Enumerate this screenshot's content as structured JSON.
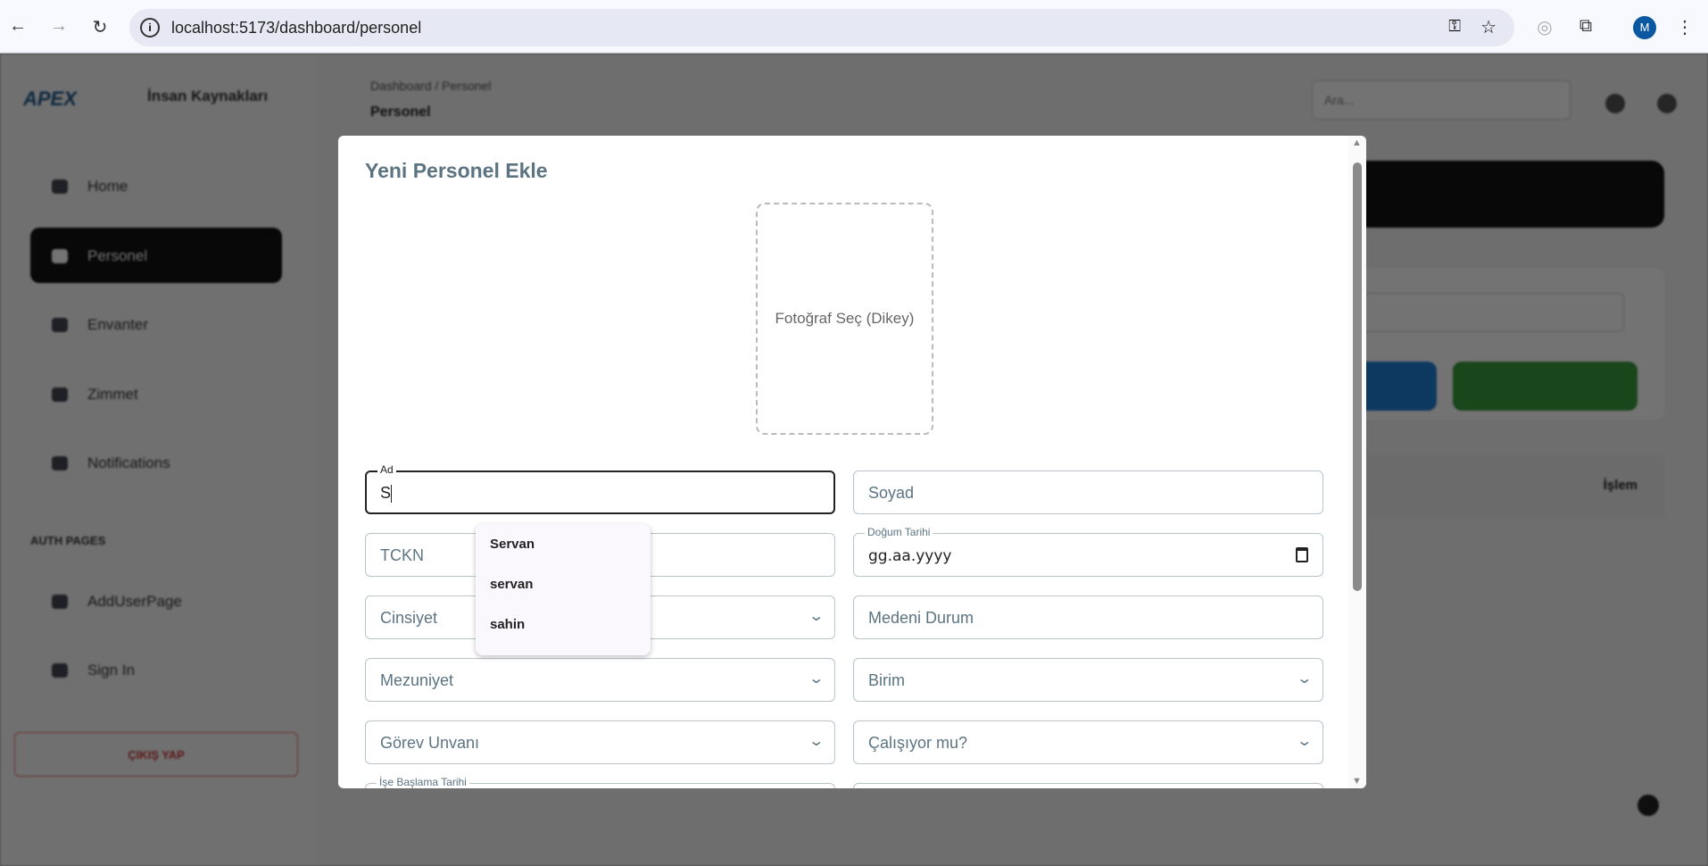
{
  "browser": {
    "url": "localhost:5173/dashboard/personel",
    "avatar_letter": "M"
  },
  "app": {
    "logo": "APEX",
    "brand": "İnsan Kaynakları",
    "nav": [
      {
        "label": "Home"
      },
      {
        "label": "Personel",
        "active": true
      },
      {
        "label": "Envanter"
      },
      {
        "label": "Zimmet"
      },
      {
        "label": "Notifications"
      }
    ],
    "auth_section": "AUTH PAGES",
    "auth_nav": [
      {
        "label": "AddUserPage"
      },
      {
        "label": "Sign In"
      }
    ],
    "logout": "ÇIKIŞ YAP",
    "breadcrumb": "Dashboard / Personel",
    "page_title": "Personel",
    "search_placeholder": "Ara...",
    "table_header_actions": "İşlem"
  },
  "modal": {
    "title": "Yeni Personel Ekle",
    "photo_label": "Fotoğraf Seç (Dikey)",
    "fields": {
      "ad": {
        "label": "Ad",
        "value": "S"
      },
      "soyad": {
        "placeholder": "Soyad"
      },
      "tckn": {
        "placeholder": "TCKN"
      },
      "dogum": {
        "label": "Doğum Tarihi",
        "value": "gg.aa.yyyy"
      },
      "cinsiyet": {
        "placeholder": "Cinsiyet"
      },
      "medeni": {
        "placeholder": "Medeni Durum"
      },
      "mezuniyet": {
        "placeholder": "Mezuniyet"
      },
      "birim": {
        "placeholder": "Birim"
      },
      "gorev": {
        "placeholder": "Görev Unvanı"
      },
      "calisiyor": {
        "placeholder": "Çalışıyor mu?"
      },
      "ise_baslama": {
        "label": "İşe Başlama Tarihi"
      }
    },
    "autocomplete": [
      "Servan",
      "servan",
      "sahin"
    ]
  }
}
